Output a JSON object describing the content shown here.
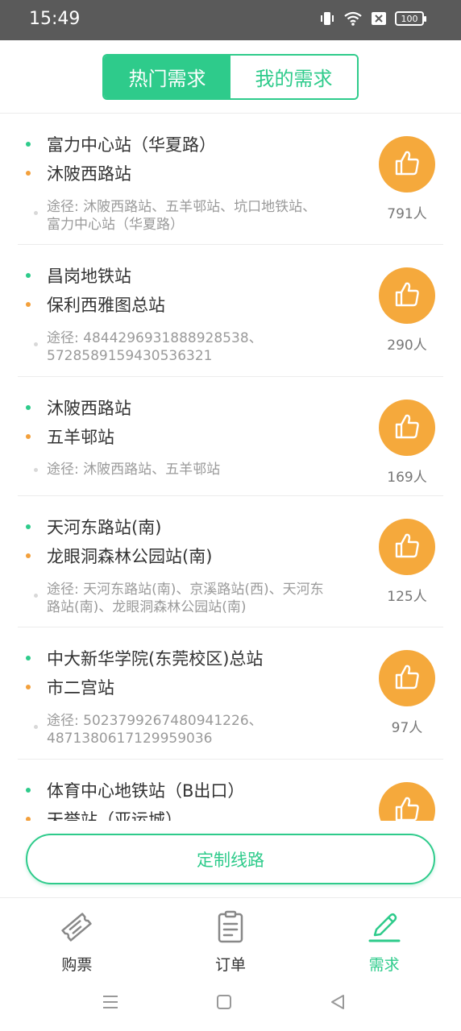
{
  "status_bar": {
    "time": "15:49",
    "battery": "100"
  },
  "segments": {
    "hot": "热门需求",
    "mine": "我的需求"
  },
  "items": [
    {
      "start": "富力中心站（华夏路）",
      "end": "沐陂西路站",
      "via_line1": "途径: 沐陂西路站、五羊邨站、坑口地铁站、",
      "via_line2": "富力中心站（华夏路）",
      "count": "791人"
    },
    {
      "start": "昌岗地铁站",
      "end": "保利西雅图总站",
      "via_line1": "途径: 4844296931888928538、",
      "via_line2": "5728589159430536321",
      "count": "290人"
    },
    {
      "start": "沐陂西路站",
      "end": "五羊邨站",
      "via_line1": "途径: 沐陂西路站、五羊邨站",
      "via_line2": "",
      "count": "169人"
    },
    {
      "start": "天河东路站(南)",
      "end": "龙眼洞森林公园站(南)",
      "via_line1": "途径: 天河东路站(南)、京溪路站(西)、天河东",
      "via_line2": "路站(南)、龙眼洞森林公园站(南)",
      "count": "125人"
    },
    {
      "start": "中大新华学院(东莞校区)总站",
      "end": "市二宫站",
      "via_line1": "途径: 5023799267480941226、",
      "via_line2": "4871380617129959036",
      "count": "97人"
    },
    {
      "start": "体育中心地铁站（B出口）",
      "end": "天誉站（亚运城）",
      "via_line1": "",
      "via_line2": "",
      "count": ""
    }
  ],
  "custom_button": "定制线路",
  "tabs": {
    "buy": "购票",
    "orders": "订单",
    "demand": "需求"
  },
  "colors": {
    "accent": "#2ecb8b",
    "like": "#f5a93c"
  },
  "icons": [
    "vibrate-icon",
    "wifi-icon",
    "sim-x-icon",
    "battery-icon",
    "thumbs-up-icon",
    "ticket-icon",
    "clipboard-icon",
    "pen-icon",
    "menu-icon",
    "home-icon",
    "back-icon"
  ]
}
